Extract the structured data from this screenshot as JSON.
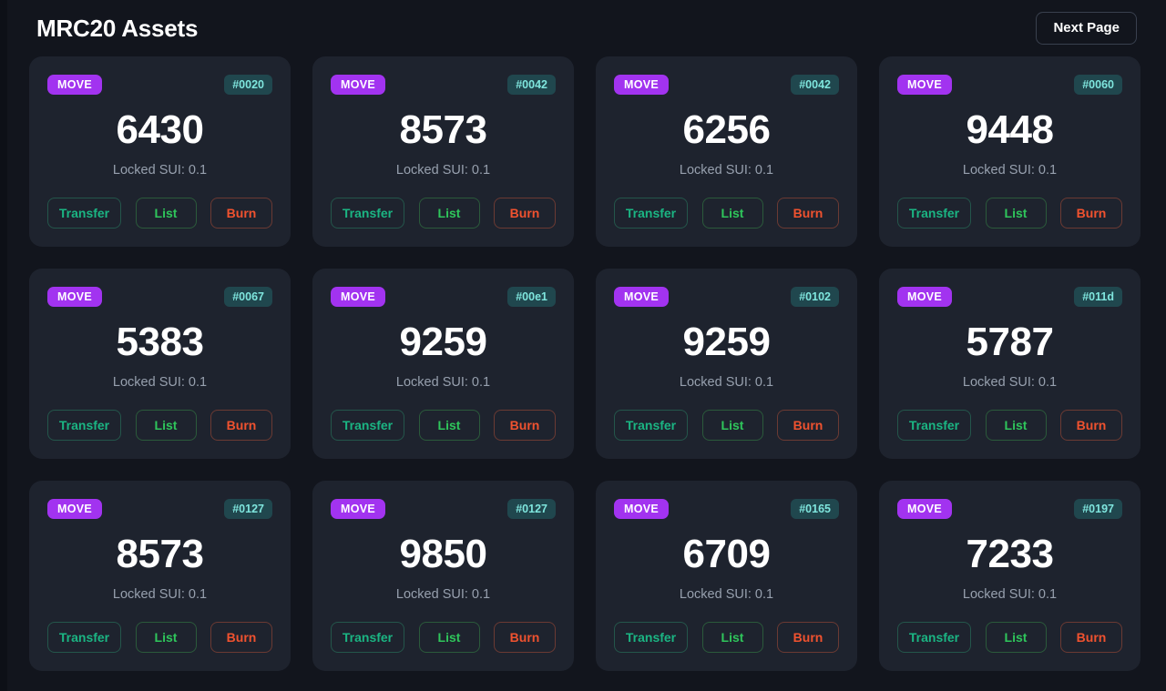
{
  "header": {
    "title": "MRC20 Assets",
    "next_page_label": "Next Page"
  },
  "card_labels": {
    "locked_prefix": "Locked SUI:",
    "transfer": "Transfer",
    "list": "List",
    "burn": "Burn"
  },
  "colors": {
    "page_background": "#12151d",
    "card_background": "#1e232e",
    "tick_badge": "#a233f0",
    "id_badge_bg": "#20474e",
    "id_badge_text": "#7fe6de",
    "transfer": "#1bb583",
    "list": "#2fc55b",
    "burn": "#f0522f",
    "amount_text": "#ffffff",
    "locked_text": "#97a0ae"
  },
  "assets": [
    {
      "tick": "MOVE",
      "id": "#0020",
      "amount": "6430",
      "locked": "Locked SUI: 0.1"
    },
    {
      "tick": "MOVE",
      "id": "#0042",
      "amount": "8573",
      "locked": "Locked SUI: 0.1"
    },
    {
      "tick": "MOVE",
      "id": "#0042",
      "amount": "6256",
      "locked": "Locked SUI: 0.1"
    },
    {
      "tick": "MOVE",
      "id": "#0060",
      "amount": "9448",
      "locked": "Locked SUI: 0.1"
    },
    {
      "tick": "MOVE",
      "id": "#0067",
      "amount": "5383",
      "locked": "Locked SUI: 0.1"
    },
    {
      "tick": "MOVE",
      "id": "#00e1",
      "amount": "9259",
      "locked": "Locked SUI: 0.1"
    },
    {
      "tick": "MOVE",
      "id": "#0102",
      "amount": "9259",
      "locked": "Locked SUI: 0.1"
    },
    {
      "tick": "MOVE",
      "id": "#011d",
      "amount": "5787",
      "locked": "Locked SUI: 0.1"
    },
    {
      "tick": "MOVE",
      "id": "#0127",
      "amount": "8573",
      "locked": "Locked SUI: 0.1"
    },
    {
      "tick": "MOVE",
      "id": "#0127",
      "amount": "9850",
      "locked": "Locked SUI: 0.1"
    },
    {
      "tick": "MOVE",
      "id": "#0165",
      "amount": "6709",
      "locked": "Locked SUI: 0.1"
    },
    {
      "tick": "MOVE",
      "id": "#0197",
      "amount": "7233",
      "locked": "Locked SUI: 0.1"
    }
  ]
}
